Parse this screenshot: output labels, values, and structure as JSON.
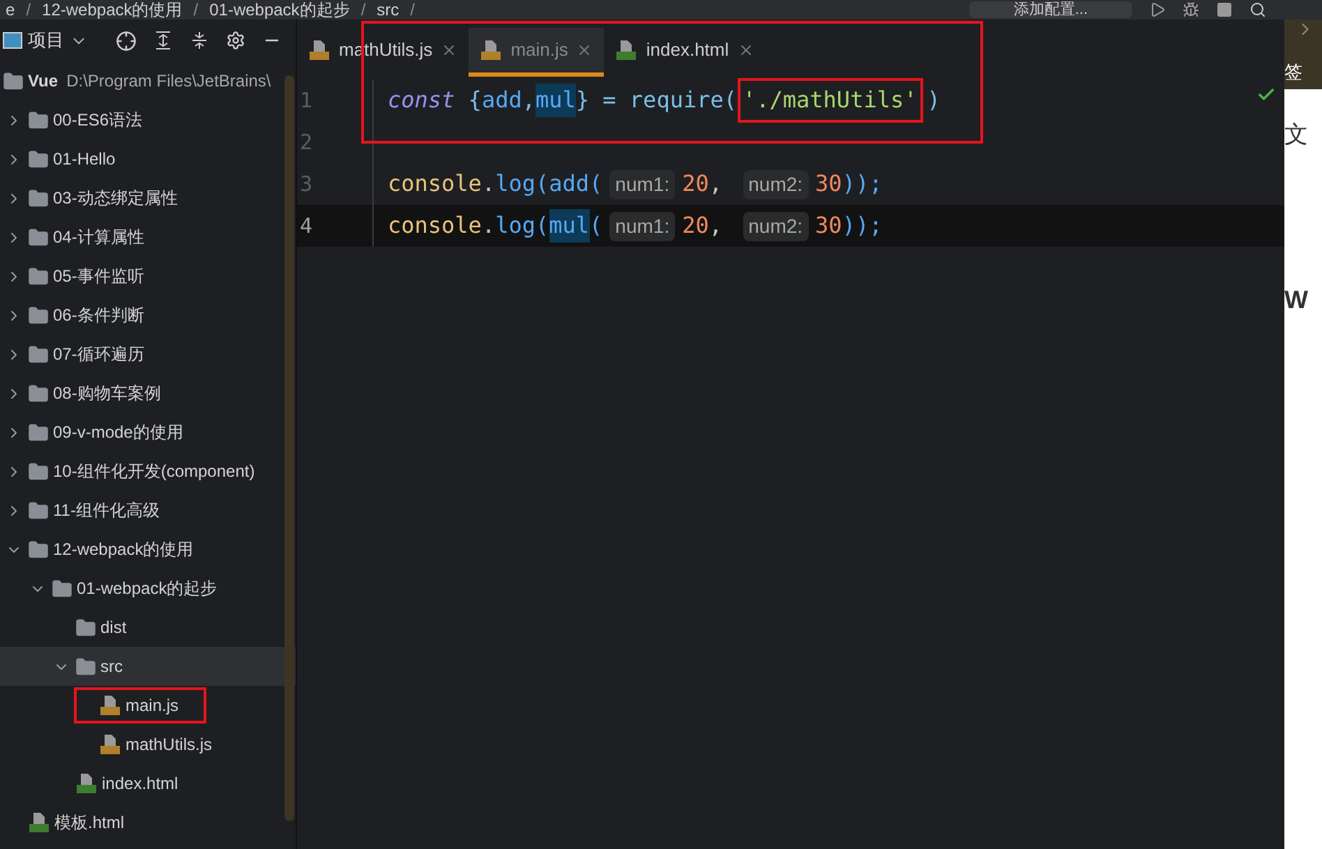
{
  "breadcrumb": [
    {
      "label": "e",
      "separator": "/"
    },
    {
      "label": "12-webpack的使用",
      "separator": "/"
    },
    {
      "label": "01-webpack的起步",
      "separator": "/"
    },
    {
      "label": "src",
      "separator": "/"
    }
  ],
  "run_config": "添加配置...",
  "project_panel": {
    "title": "项目",
    "tree": [
      {
        "name": "Vue",
        "path": "D:\\Program Files\\JetBrains\\",
        "kind": "folder",
        "selected": false,
        "children": [
          {
            "name": "00-ES6语法",
            "kind": "folder",
            "expanded": false,
            "selected": false
          },
          {
            "name": "01-Hello",
            "kind": "folder",
            "expanded": false,
            "selected": false
          },
          {
            "name": "03-动态绑定属性",
            "kind": "folder",
            "expanded": false,
            "selected": false
          },
          {
            "name": "04-计算属性",
            "kind": "folder",
            "expanded": false,
            "selected": false
          },
          {
            "name": "05-事件监听",
            "kind": "folder",
            "expanded": false,
            "selected": false
          },
          {
            "name": "06-条件判断",
            "kind": "folder",
            "expanded": false,
            "selected": false
          },
          {
            "name": "07-循环遍历",
            "kind": "folder",
            "expanded": false,
            "selected": false
          },
          {
            "name": "08-购物车案例",
            "kind": "folder",
            "expanded": false,
            "selected": false
          },
          {
            "name": "09-v-mode的使用",
            "kind": "folder",
            "expanded": false,
            "selected": false
          },
          {
            "name": "10-组件化开发(component)",
            "kind": "folder",
            "expanded": false,
            "selected": false
          },
          {
            "name": "11-组件化高级",
            "kind": "folder",
            "expanded": false,
            "selected": false
          },
          {
            "name": "12-webpack的使用",
            "kind": "folder",
            "expanded": true,
            "selected": false,
            "children": [
              {
                "name": "01-webpack的起步",
                "kind": "folder",
                "expanded": true,
                "selected": false,
                "children": [
                  {
                    "name": "dist",
                    "kind": "leaf-folder",
                    "selected": false
                  },
                  {
                    "name": "src",
                    "kind": "folder",
                    "expanded": true,
                    "selected": true,
                    "children": [
                      {
                        "name": "main.js",
                        "kind": "js",
                        "selected": false,
                        "annotated": true
                      },
                      {
                        "name": "mathUtils.js",
                        "kind": "js",
                        "selected": false,
                        "annotated": false
                      }
                    ]
                  },
                  {
                    "name": "index.html",
                    "kind": "html",
                    "selected": false,
                    "annotated": false
                  }
                ]
              }
            ]
          },
          {
            "name": "模板.html",
            "kind": "html",
            "selected": false,
            "annotated": false
          }
        ]
      }
    ]
  },
  "tabs": [
    {
      "label": "mathUtils.js",
      "kind": "js",
      "selected": false
    },
    {
      "label": "main.js",
      "kind": "js",
      "selected": true
    },
    {
      "label": "index.html",
      "kind": "html",
      "selected": false
    }
  ],
  "code_lines": [
    {
      "number": "1",
      "current": false,
      "tokens": [
        {
          "kind": "keyword",
          "text": "const"
        },
        {
          "kind": "punct",
          "text": " {"
        },
        {
          "kind": "var",
          "text": "add"
        },
        {
          "kind": "punct",
          "text": ","
        },
        {
          "kind": "var",
          "text": "mul",
          "highlighted": true
        },
        {
          "kind": "punct",
          "text": "} = "
        },
        {
          "kind": "call",
          "text": "require"
        },
        {
          "kind": "punct",
          "text": "("
        },
        {
          "kind": "string",
          "text": "'./mathUtils'",
          "annotated": true
        },
        {
          "kind": "punct",
          "text": ")"
        }
      ]
    },
    {
      "number": "2",
      "current": false
    },
    {
      "number": "3",
      "current": false,
      "tokens": [
        {
          "kind": "object",
          "text": "console"
        },
        {
          "kind": "plain",
          "text": "."
        },
        {
          "kind": "var",
          "text": "log"
        },
        {
          "kind": "var",
          "text": "("
        },
        {
          "kind": "var",
          "text": "add",
          "highlighted": false
        },
        {
          "kind": "var",
          "text": "("
        },
        {
          "kind": "hint",
          "text": "num1:"
        },
        {
          "kind": "number",
          "text": "20"
        },
        {
          "kind": "plain",
          "text": ", "
        },
        {
          "kind": "hint",
          "text": "num2:"
        },
        {
          "kind": "number",
          "text": "30"
        },
        {
          "kind": "var",
          "text": "));"
        }
      ]
    },
    {
      "number": "4",
      "current": true,
      "tokens": [
        {
          "kind": "object",
          "text": "console"
        },
        {
          "kind": "plain",
          "text": "."
        },
        {
          "kind": "var",
          "text": "log"
        },
        {
          "kind": "var",
          "text": "("
        },
        {
          "kind": "var",
          "text": "mul",
          "highlighted": true
        },
        {
          "kind": "var",
          "text": "("
        },
        {
          "kind": "hint",
          "text": "num1:"
        },
        {
          "kind": "number",
          "text": "20"
        },
        {
          "kind": "plain",
          "text": ", "
        },
        {
          "kind": "hint",
          "text": "num2:"
        },
        {
          "kind": "number",
          "text": "30"
        },
        {
          "kind": "var",
          "text": "));"
        }
      ]
    }
  ],
  "side_panel": {
    "header_text": "签",
    "texts": [
      "文",
      "W"
    ]
  }
}
